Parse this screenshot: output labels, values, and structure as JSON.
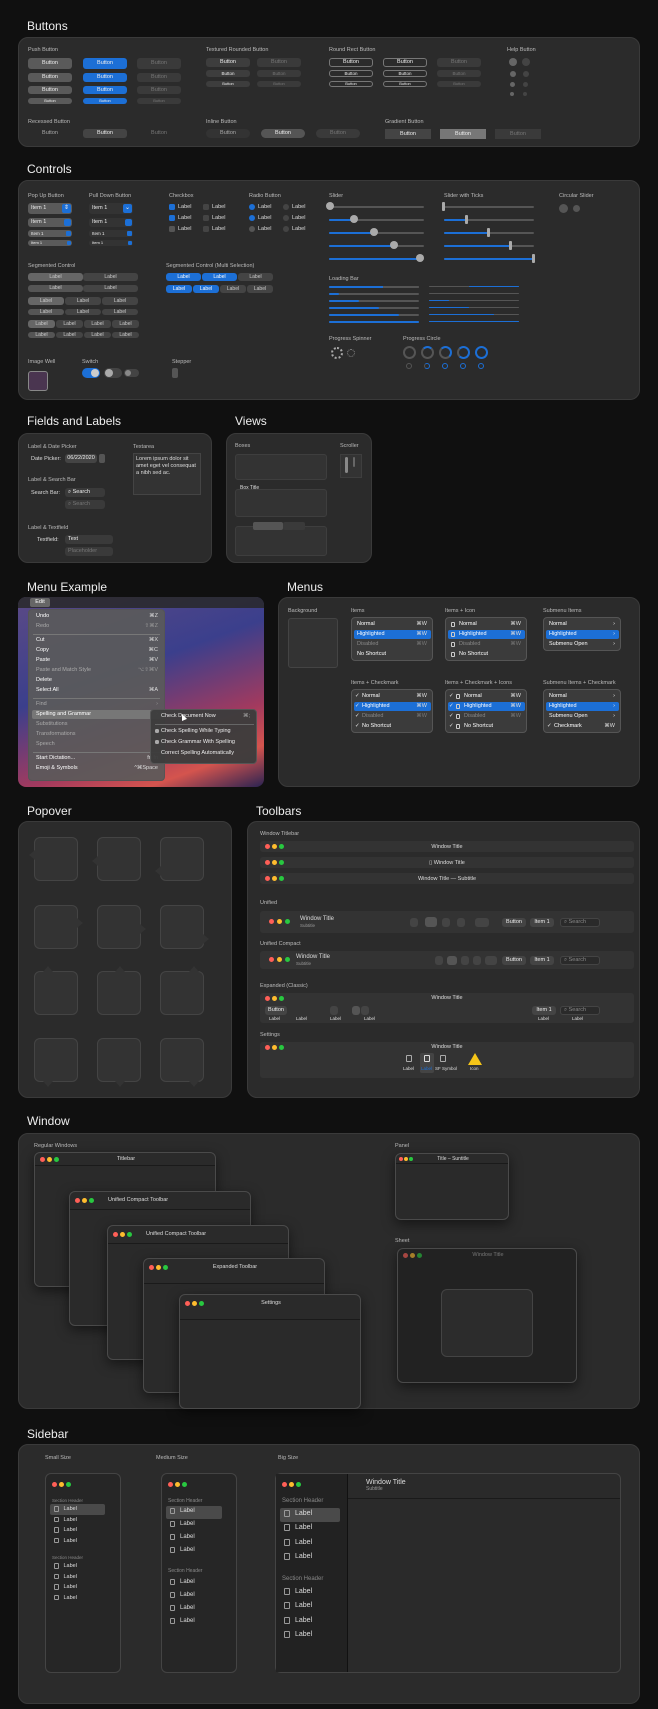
{
  "sections": {
    "buttons": "Buttons",
    "controls": "Controls",
    "fields": "Fields and Labels",
    "views": "Views",
    "menu_example": "Menu Example",
    "menus": "Menus",
    "popover": "Popover",
    "toolbars": "Toolbars",
    "window": "Window",
    "sidebar": "Sidebar"
  },
  "buttons": {
    "push": "Push Button",
    "textured": "Textured Rounded Button",
    "roundrect": "Round Rect Button",
    "help": "Help Button",
    "recessed": "Recessed Button",
    "inline": "Inline Button",
    "gradient": "Gradient Button",
    "label": "Button"
  },
  "controls": {
    "popup": "Pop Up Button",
    "pulldown": "Pull Down Button",
    "checkbox": "Checkbox",
    "radio": "Radio Button",
    "slider": "Slider",
    "slider_ticks": "Slider with Ticks",
    "circular": "Circular Slider",
    "segmented": "Segmented Control",
    "segmented_multi": "Segmented Control (Multi Selection)",
    "loading": "Loading Bar",
    "spinner": "Progress Spinner",
    "circle": "Progress Circle",
    "image_well": "Image Well",
    "switch": "Switch",
    "stepper": "Stepper",
    "item": "Item 1",
    "label": "Label"
  },
  "fields": {
    "datepicker": "Label & Date Picker",
    "date_label": "Date Picker:",
    "date_value": "06/22/2020",
    "textarea": "Textarea",
    "lorem": "Lorem ipsum dolor sit amet eget vel consequat a nibh sed ac.",
    "searchbar": "Label & Search Bar",
    "search_label": "Search Bar:",
    "search": "Search",
    "textfield_h": "Label & Textfield",
    "textfield_label": "Textfield:",
    "text": "Text",
    "placeholder": "Placeholder"
  },
  "views": {
    "boxes": "Boxes",
    "scroller": "Scroller",
    "box_title": "Box Title"
  },
  "menu_example": {
    "edit": "Edit",
    "items": [
      {
        "l": "Undo",
        "s": "⌘Z"
      },
      {
        "l": "Redo",
        "s": "⇧⌘Z",
        "dis": true
      },
      {
        "l": "Cut",
        "s": "⌘X"
      },
      {
        "l": "Copy",
        "s": "⌘C"
      },
      {
        "l": "Paste",
        "s": "⌘V"
      },
      {
        "l": "Paste and Match Style",
        "s": "⌥⇧⌘V",
        "dis": true
      },
      {
        "l": "Delete",
        "s": ""
      },
      {
        "l": "Select All",
        "s": "⌘A"
      },
      {
        "l": "Find",
        "s": "›",
        "dis": true
      },
      {
        "l": "Spelling and Grammar",
        "s": "›",
        "hl": true
      },
      {
        "l": "Substitutions",
        "s": "›",
        "dis": true
      },
      {
        "l": "Transformations",
        "s": "›",
        "dis": true
      },
      {
        "l": "Speech",
        "s": "›",
        "dis": true
      },
      {
        "l": "Start Dictation...",
        "s": "fn fn"
      },
      {
        "l": "Emoji & Symbols",
        "s": "^⌘Space"
      }
    ],
    "sub": [
      "Check Document Now",
      "Check Spelling While Typing",
      "Check Grammar With Spelling",
      "Correct Spelling Automatically"
    ],
    "sub_short": "⌘;"
  },
  "menus": {
    "background": "Background",
    "items": "Items",
    "items_icon": "Items + Icon",
    "submenu": "Submenu Items",
    "items_check": "Items + Checkmark",
    "items_check_icon": "Items + Checkmark + Icons",
    "submenu_check": "Submenu Items + Checkmark",
    "normal": "Normal",
    "highlighted": "Highlighted",
    "disabled": "Disabled",
    "noshortcut": "No Shortcut",
    "submenu_open": "Submenu Open",
    "checkmark": "Checkmark",
    "shortcut": "⌘W"
  },
  "toolbars": {
    "window_titlebar": "Window Titlebar",
    "window_title": "Window Title",
    "subtitle": "Subtitle",
    "title_sub": "Window Title — Subtitle",
    "unified": "Unified",
    "unified_compact": "Unified Compact",
    "expanded": "Expanded (Classic)",
    "settings": "Settings",
    "button": "Button",
    "item": "Item 1",
    "search": "Search",
    "label": "Label",
    "sf": "SF Symbol",
    "icon": "Icon"
  },
  "window": {
    "regular": "Regular Windows",
    "panel": "Panel",
    "sheet": "Sheet",
    "titlebar": "Titlebar",
    "ucompact1": "Unified Compact Toolbar",
    "ucompact2": "Unified Compact Toolbar",
    "expanded": "Expanded Toolbar",
    "settings": "Settings",
    "panel_title": "Title – Suntitle",
    "sheet_title": "Window Title"
  },
  "sidebar": {
    "small": "Small Size",
    "medium": "Medium Size",
    "big": "Big Size",
    "section": "Section Header",
    "label": "Label",
    "title": "Window Title",
    "subtitle": "Subtitle"
  }
}
